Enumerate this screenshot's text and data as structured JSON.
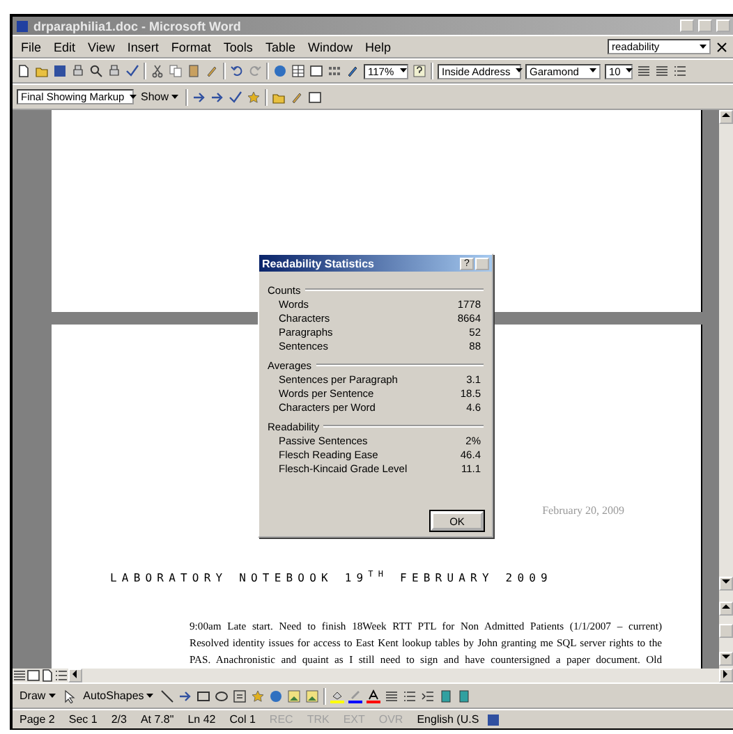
{
  "window": {
    "title": "drparaphilia1.doc - Microsoft Word"
  },
  "menu": [
    "File",
    "Edit",
    "View",
    "Insert",
    "Format",
    "Tools",
    "Table",
    "Window",
    "Help"
  ],
  "help_search": {
    "value": "readability"
  },
  "formatting": {
    "zoom": "117%",
    "style": "Inside Address",
    "font": "Garamond",
    "size": "10"
  },
  "reviewing": {
    "view": "Final Showing Markup",
    "show": "Show"
  },
  "dialog": {
    "title": "Readability Statistics",
    "help": "?",
    "sections": [
      {
        "title": "Counts",
        "rows": [
          {
            "label": "Words",
            "value": "1778"
          },
          {
            "label": "Characters",
            "value": "8664"
          },
          {
            "label": "Paragraphs",
            "value": "52"
          },
          {
            "label": "Sentences",
            "value": "88"
          }
        ]
      },
      {
        "title": "Averages",
        "rows": [
          {
            "label": "Sentences per Paragraph",
            "value": "3.1"
          },
          {
            "label": "Words per Sentence",
            "value": "18.5"
          },
          {
            "label": "Characters per Word",
            "value": "4.6"
          }
        ]
      },
      {
        "title": "Readability",
        "rows": [
          {
            "label": "Passive Sentences",
            "value": "2%"
          },
          {
            "label": "Flesch Reading Ease",
            "value": "46.4"
          },
          {
            "label": "Flesch-Kincaid Grade Level",
            "value": "11.1"
          }
        ]
      }
    ],
    "ok": "OK"
  },
  "document": {
    "date": "February 20, 2009",
    "heading": "LABORATORY NOTEBOOK 19$^{TH}$ FEBRUARY 2009",
    "lines": [
      "9:00am Late start. Need to finish 18Week RTT PTL for Non Admitted Patients (1/1/2007 – current)",
      "Resolved identity issues for access to East Kent lookup tables by John granting me SQL server rights to the",
      "PAS. Anachronistic and quaint as I still need to sign and have countersigned a paper document. Old"
    ]
  },
  "drawing": {
    "draw": "Draw",
    "autoshapes": "AutoShapes"
  },
  "status_bar": [
    {
      "text": "Page 2",
      "disabled": false
    },
    {
      "text": "Sec 1",
      "disabled": false
    },
    {
      "text": "2/3",
      "disabled": false
    },
    {
      "text": "At 7.8\"",
      "disabled": false
    },
    {
      "text": "Ln 42",
      "disabled": false
    },
    {
      "text": "Col 1",
      "disabled": false
    },
    {
      "text": "REC",
      "disabled": true
    },
    {
      "text": "TRK",
      "disabled": true
    },
    {
      "text": "EXT",
      "disabled": true
    },
    {
      "text": "OVR",
      "disabled": true
    },
    {
      "text": "English (U.S",
      "disabled": false
    }
  ]
}
